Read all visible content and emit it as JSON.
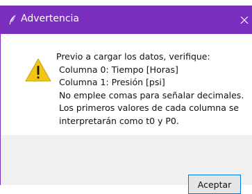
{
  "dialog": {
    "title": "Advertencia",
    "icon": "feather-icon",
    "close_icon": "close-icon",
    "warning_icon": "warning-icon",
    "message_lines": [
      "Previo a cargar los datos, verifique:",
      "Columna 0: Tiempo [Horas]",
      "Columna 1: Presión [psi]",
      "No emplee comas para señalar decimales.",
      "Los primeros valores de cada columna se",
      "interpretarán como t0 y P0."
    ],
    "accept_label": "Aceptar"
  },
  "colors": {
    "titlebar": "#7b2fbe",
    "button_border": "#0078d7",
    "warning_fill": "#f2c515"
  }
}
